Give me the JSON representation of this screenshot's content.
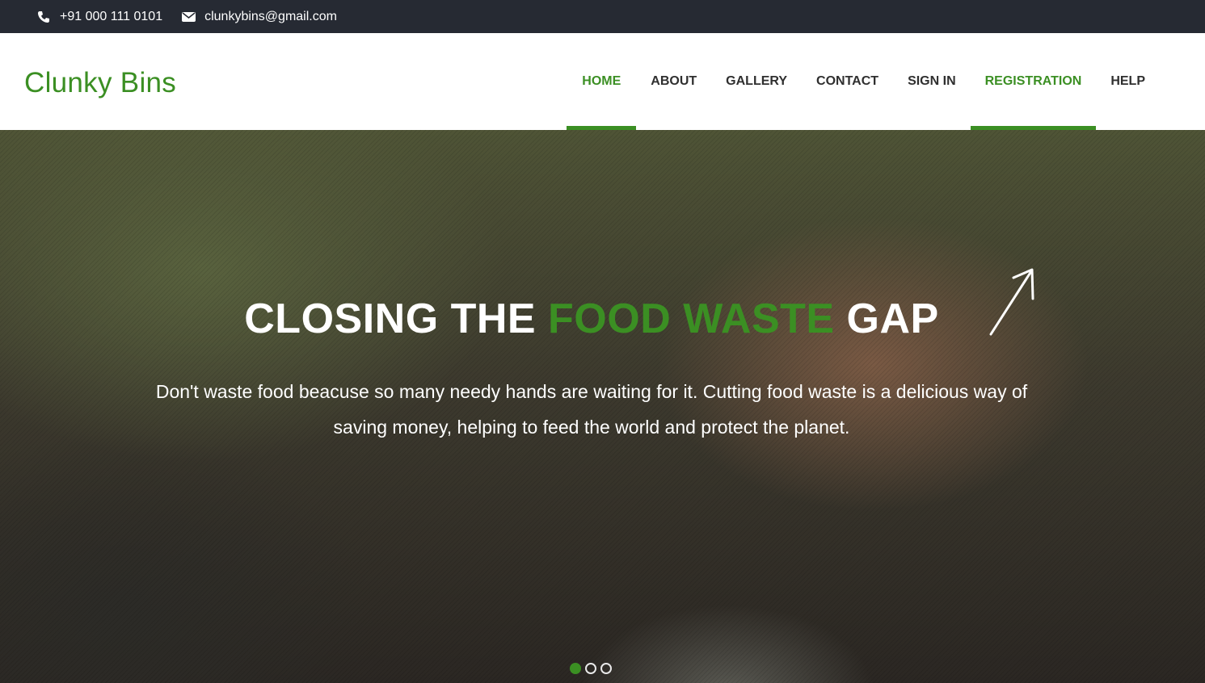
{
  "topbar": {
    "phone": "+91 000 111 0101",
    "email": "clunkybins@gmail.com",
    "phone_icon": "phone-icon",
    "email_icon": "envelope-icon"
  },
  "header": {
    "logo": "Clunky Bins",
    "nav": [
      {
        "label": "HOME",
        "active": true
      },
      {
        "label": "ABOUT",
        "active": false
      },
      {
        "label": "GALLERY",
        "active": false
      },
      {
        "label": "CONTACT",
        "active": false
      },
      {
        "label": "SIGN IN",
        "active": false
      },
      {
        "label": "REGISTRATION",
        "active": true
      },
      {
        "label": "HELP",
        "active": false
      }
    ]
  },
  "hero": {
    "title_part1": "CLOSING THE ",
    "title_accent": "FOOD WASTE",
    "title_part2": " GAP",
    "text": "Don't waste food beacuse so many needy hands are waiting for it. Cutting food waste is a delicious way of saving money, helping to feed the world and protect the planet.",
    "slides": 3,
    "active_slide": 1
  },
  "colors": {
    "brand_green": "#3b8f23",
    "topbar_bg": "#262a33"
  }
}
